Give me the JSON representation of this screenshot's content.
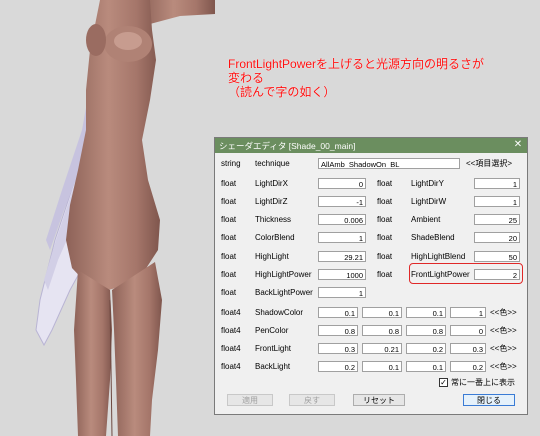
{
  "annotation": {
    "text": "FrontLightPowerを上げると光源方向の明るさが\n変わる\n（読んで字の如く）"
  },
  "window": {
    "title": "シェーダエディタ  [Shade_00_main]",
    "close_icon": "close-icon",
    "technique": {
      "type": "string",
      "name": "technique",
      "value": "AllAmb_ShadowOn_BL",
      "select_label": "<<項目選択>"
    },
    "left_params": [
      {
        "type": "float",
        "name": "LightDirX",
        "value": "0"
      },
      {
        "type": "float",
        "name": "LightDirZ",
        "value": "-1"
      },
      {
        "type": "float",
        "name": "Thickness",
        "value": "0.006"
      },
      {
        "type": "float",
        "name": "ColorBlend",
        "value": "1"
      },
      {
        "type": "float",
        "name": "HighLight",
        "value": "29.21"
      },
      {
        "type": "float",
        "name": "HighLightPower",
        "value": "1000"
      },
      {
        "type": "float",
        "name": "BackLightPower",
        "value": "1"
      }
    ],
    "right_params": [
      {
        "type": "float",
        "name": "LightDirY",
        "value": "1"
      },
      {
        "type": "float",
        "name": "LightDirW",
        "value": "1"
      },
      {
        "type": "float",
        "name": "Ambient",
        "value": "25"
      },
      {
        "type": "float",
        "name": "ShadeBlend",
        "value": "20"
      },
      {
        "type": "float",
        "name": "HighLightBlend",
        "value": "50"
      },
      {
        "type": "float",
        "name": "FrontLightPower",
        "value": "2"
      }
    ],
    "color_params": [
      {
        "type": "float4",
        "name": "ShadowColor",
        "values": [
          "0.1",
          "0.1",
          "0.1",
          "1"
        ],
        "color_label": "<<色>>"
      },
      {
        "type": "float4",
        "name": "PenColor",
        "values": [
          "0.8",
          "0.8",
          "0.8",
          "0"
        ],
        "color_label": "<<色>>"
      },
      {
        "type": "float4",
        "name": "FrontLight",
        "values": [
          "0.3",
          "0.21",
          "0.2",
          "0.3"
        ],
        "color_label": "<<色>>"
      },
      {
        "type": "float4",
        "name": "BackLight",
        "values": [
          "0.2",
          "0.1",
          "0.1",
          "0.2"
        ],
        "color_label": "<<色>>"
      }
    ],
    "topmost_label": "常に一番上に表示",
    "topmost_checked": "✓",
    "buttons": {
      "apply": "適用",
      "revert": "戻す",
      "reset": "リセット",
      "close": "閉じる"
    }
  },
  "colors": {
    "titlebar": "#6b8e5f",
    "annotation": "#ff1010",
    "highlight_ring": "#e02828",
    "skin": "#b07f72"
  }
}
